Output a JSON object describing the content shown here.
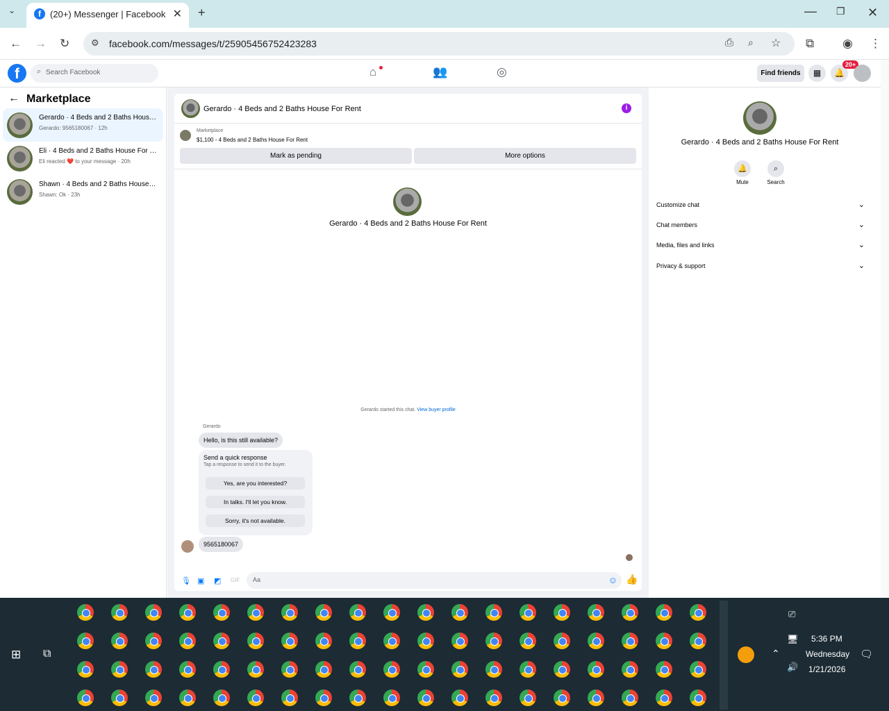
{
  "browser": {
    "tab_title": "(20+) Messenger | Facebook",
    "url": "facebook.com/messages/t/25905456752423283"
  },
  "fb_header": {
    "search_placeholder": "Search Facebook",
    "find_friends": "Find friends",
    "notif_badge": "20+"
  },
  "sidebar": {
    "title": "Marketplace",
    "conversations": [
      {
        "name": "Gerardo · 4 Beds and 2 Baths House For Rent",
        "preview": "Gerardo: 9565180067 · 12h"
      },
      {
        "name": "Eli · 4 Beds and 2 Baths House For Rent",
        "preview": "Eli reacted ❤️ to your message · 20h"
      },
      {
        "name": "Shawn · 4 Beds and 2 Baths House For Rent",
        "preview": "Shawn: Ok · 23h"
      }
    ]
  },
  "chat": {
    "header_title": "Gerardo · 4 Beds and 2 Baths House For Rent",
    "marketplace_label": "Marketplace",
    "listing": "$1,100 - 4 Beds and 2 Baths House For Rent",
    "mark_pending": "Mark as pending",
    "more_options": "More options",
    "intro_name": "Gerardo · 4 Beds and 2 Baths House For Rent",
    "started_text": "Gerardo started this chat.",
    "view_profile": "View buyer profile",
    "sender": "Gerardo",
    "message1": "Hello, is this still available?",
    "quick_title": "Send a quick response",
    "quick_sub": "Tap a response to send it to the buyer.",
    "quick_replies": [
      "Yes, are you interested?",
      "In talks. I'll let you know.",
      "Sorry, it's not available."
    ],
    "message2": "9565180067",
    "composer_placeholder": "Aa"
  },
  "right_panel": {
    "name": "Gerardo · 4 Beds and 2 Baths House For Rent",
    "mute": "Mute",
    "search": "Search",
    "sections": [
      "Customize chat",
      "Chat members",
      "Media, files and links",
      "Privacy & support"
    ]
  },
  "taskbar": {
    "time": "5:36 PM",
    "day": "Wednesday",
    "date": "1/21/2026"
  }
}
